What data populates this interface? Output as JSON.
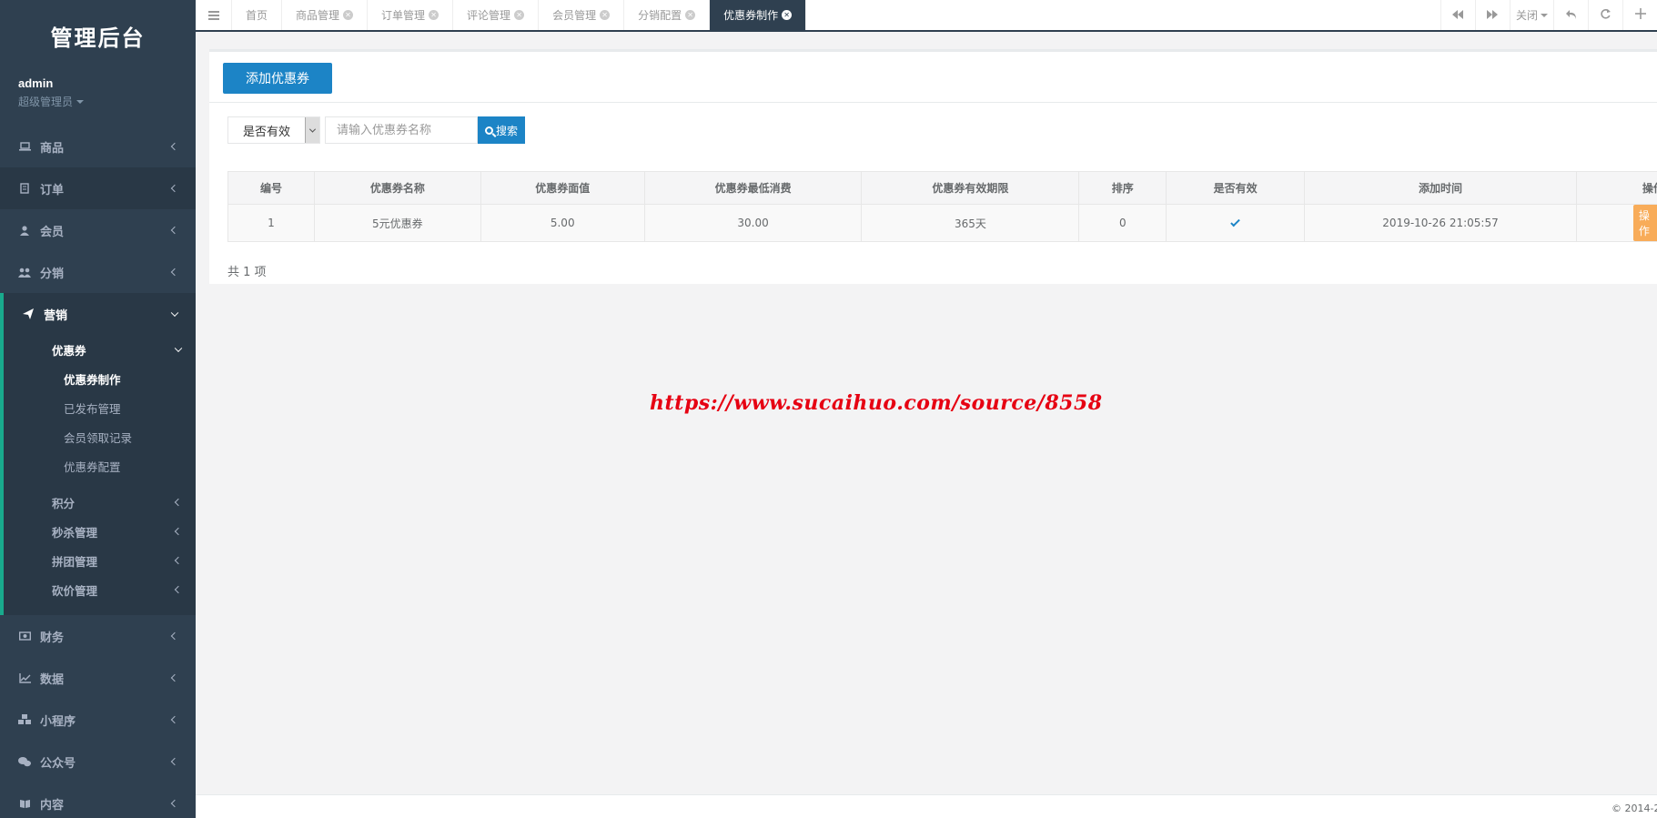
{
  "sidebar": {
    "brand": "管理后台",
    "user": {
      "name": "admin",
      "role": "超级管理员"
    },
    "items_top": [
      {
        "label": "商品",
        "icon": "laptop-icon"
      },
      {
        "label": "订单",
        "icon": "file-icon"
      },
      {
        "label": "会员",
        "icon": "user-icon"
      },
      {
        "label": "分销",
        "icon": "users-icon"
      }
    ],
    "marketing": {
      "label": "营销",
      "coupon": {
        "label": "优惠券",
        "children": [
          "优惠券制作",
          "已发布管理",
          "会员领取记录",
          "优惠券配置"
        ]
      },
      "others": [
        "积分",
        "秒杀管理",
        "拼团管理",
        "砍价管理"
      ]
    },
    "items_bottom": [
      {
        "label": "财务",
        "icon": "money-icon"
      },
      {
        "label": "数据",
        "icon": "chart-icon"
      },
      {
        "label": "小程序",
        "icon": "cubes-icon"
      },
      {
        "label": "公众号",
        "icon": "wechat-icon"
      },
      {
        "label": "内容",
        "icon": "book-icon"
      }
    ]
  },
  "tabs": [
    "首页",
    "商品管理",
    "订单管理",
    "评论管理",
    "会员管理",
    "分销配置",
    "优惠券制作"
  ],
  "tab_tools": {
    "close_label": "关闭"
  },
  "toolbar": {
    "add_label": "添加优惠券"
  },
  "filter": {
    "valid_select": "是否有效",
    "search_placeholder": "请输入优惠券名称",
    "search_label": "搜索"
  },
  "table": {
    "headers": [
      "编号",
      "优惠券名称",
      "优惠券面值",
      "优惠券最低消费",
      "优惠券有效期限",
      "排序",
      "是否有效",
      "添加时间",
      "操作"
    ],
    "rows": [
      {
        "id": "1",
        "name": "5元优惠券",
        "value": "5.00",
        "min": "30.00",
        "period": "365天",
        "sort": "0",
        "valid": true,
        "time": "2019-10-26 21:05:57",
        "op": "操作"
      }
    ]
  },
  "count_text": "共 1 项",
  "watermark": "https://www.sucaihuo.com/source/8558",
  "footer": "© 2014-2"
}
